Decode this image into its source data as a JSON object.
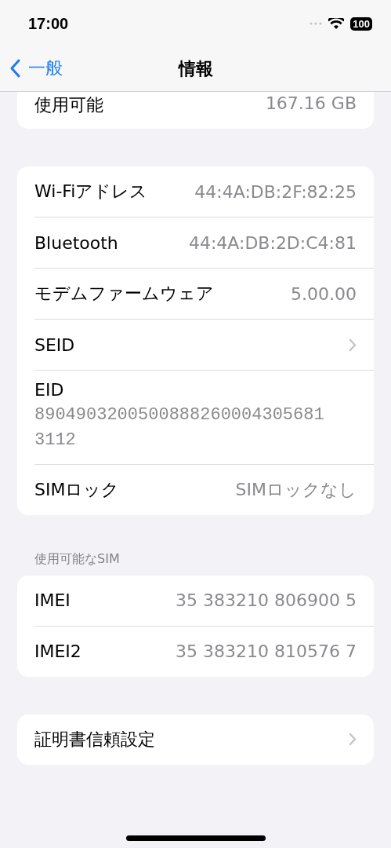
{
  "status_bar": {
    "time": "17:00",
    "battery": "100"
  },
  "nav": {
    "back": "一般",
    "title": "情報"
  },
  "sections": [
    {
      "cut_top": true,
      "rows": [
        {
          "kind": "value",
          "label": "使用可能",
          "value": "167.16 GB"
        }
      ]
    },
    {
      "rows": [
        {
          "kind": "value",
          "label": "Wi-Fiアドレス",
          "value": "44:4A:DB:2F:82:25"
        },
        {
          "kind": "value",
          "label": "Bluetooth",
          "value": "44:4A:DB:2D:C4:81"
        },
        {
          "kind": "value",
          "label": "モデムファームウェア",
          "value": "5.00.00"
        },
        {
          "kind": "link",
          "label": "SEID"
        },
        {
          "kind": "stacked",
          "label": "EID",
          "value": "89049032005008882600043056813112"
        },
        {
          "kind": "value",
          "label": "SIMロック",
          "value": "SIMロックなし"
        }
      ]
    },
    {
      "header": "使用可能なSIM",
      "rows": [
        {
          "kind": "value",
          "label": "IMEI",
          "value": "35 383210 806900 5"
        },
        {
          "kind": "value",
          "label": "IMEI2",
          "value": "35 383210 810576 7"
        }
      ]
    },
    {
      "rows": [
        {
          "kind": "link",
          "label": "証明書信頼設定"
        }
      ]
    }
  ]
}
